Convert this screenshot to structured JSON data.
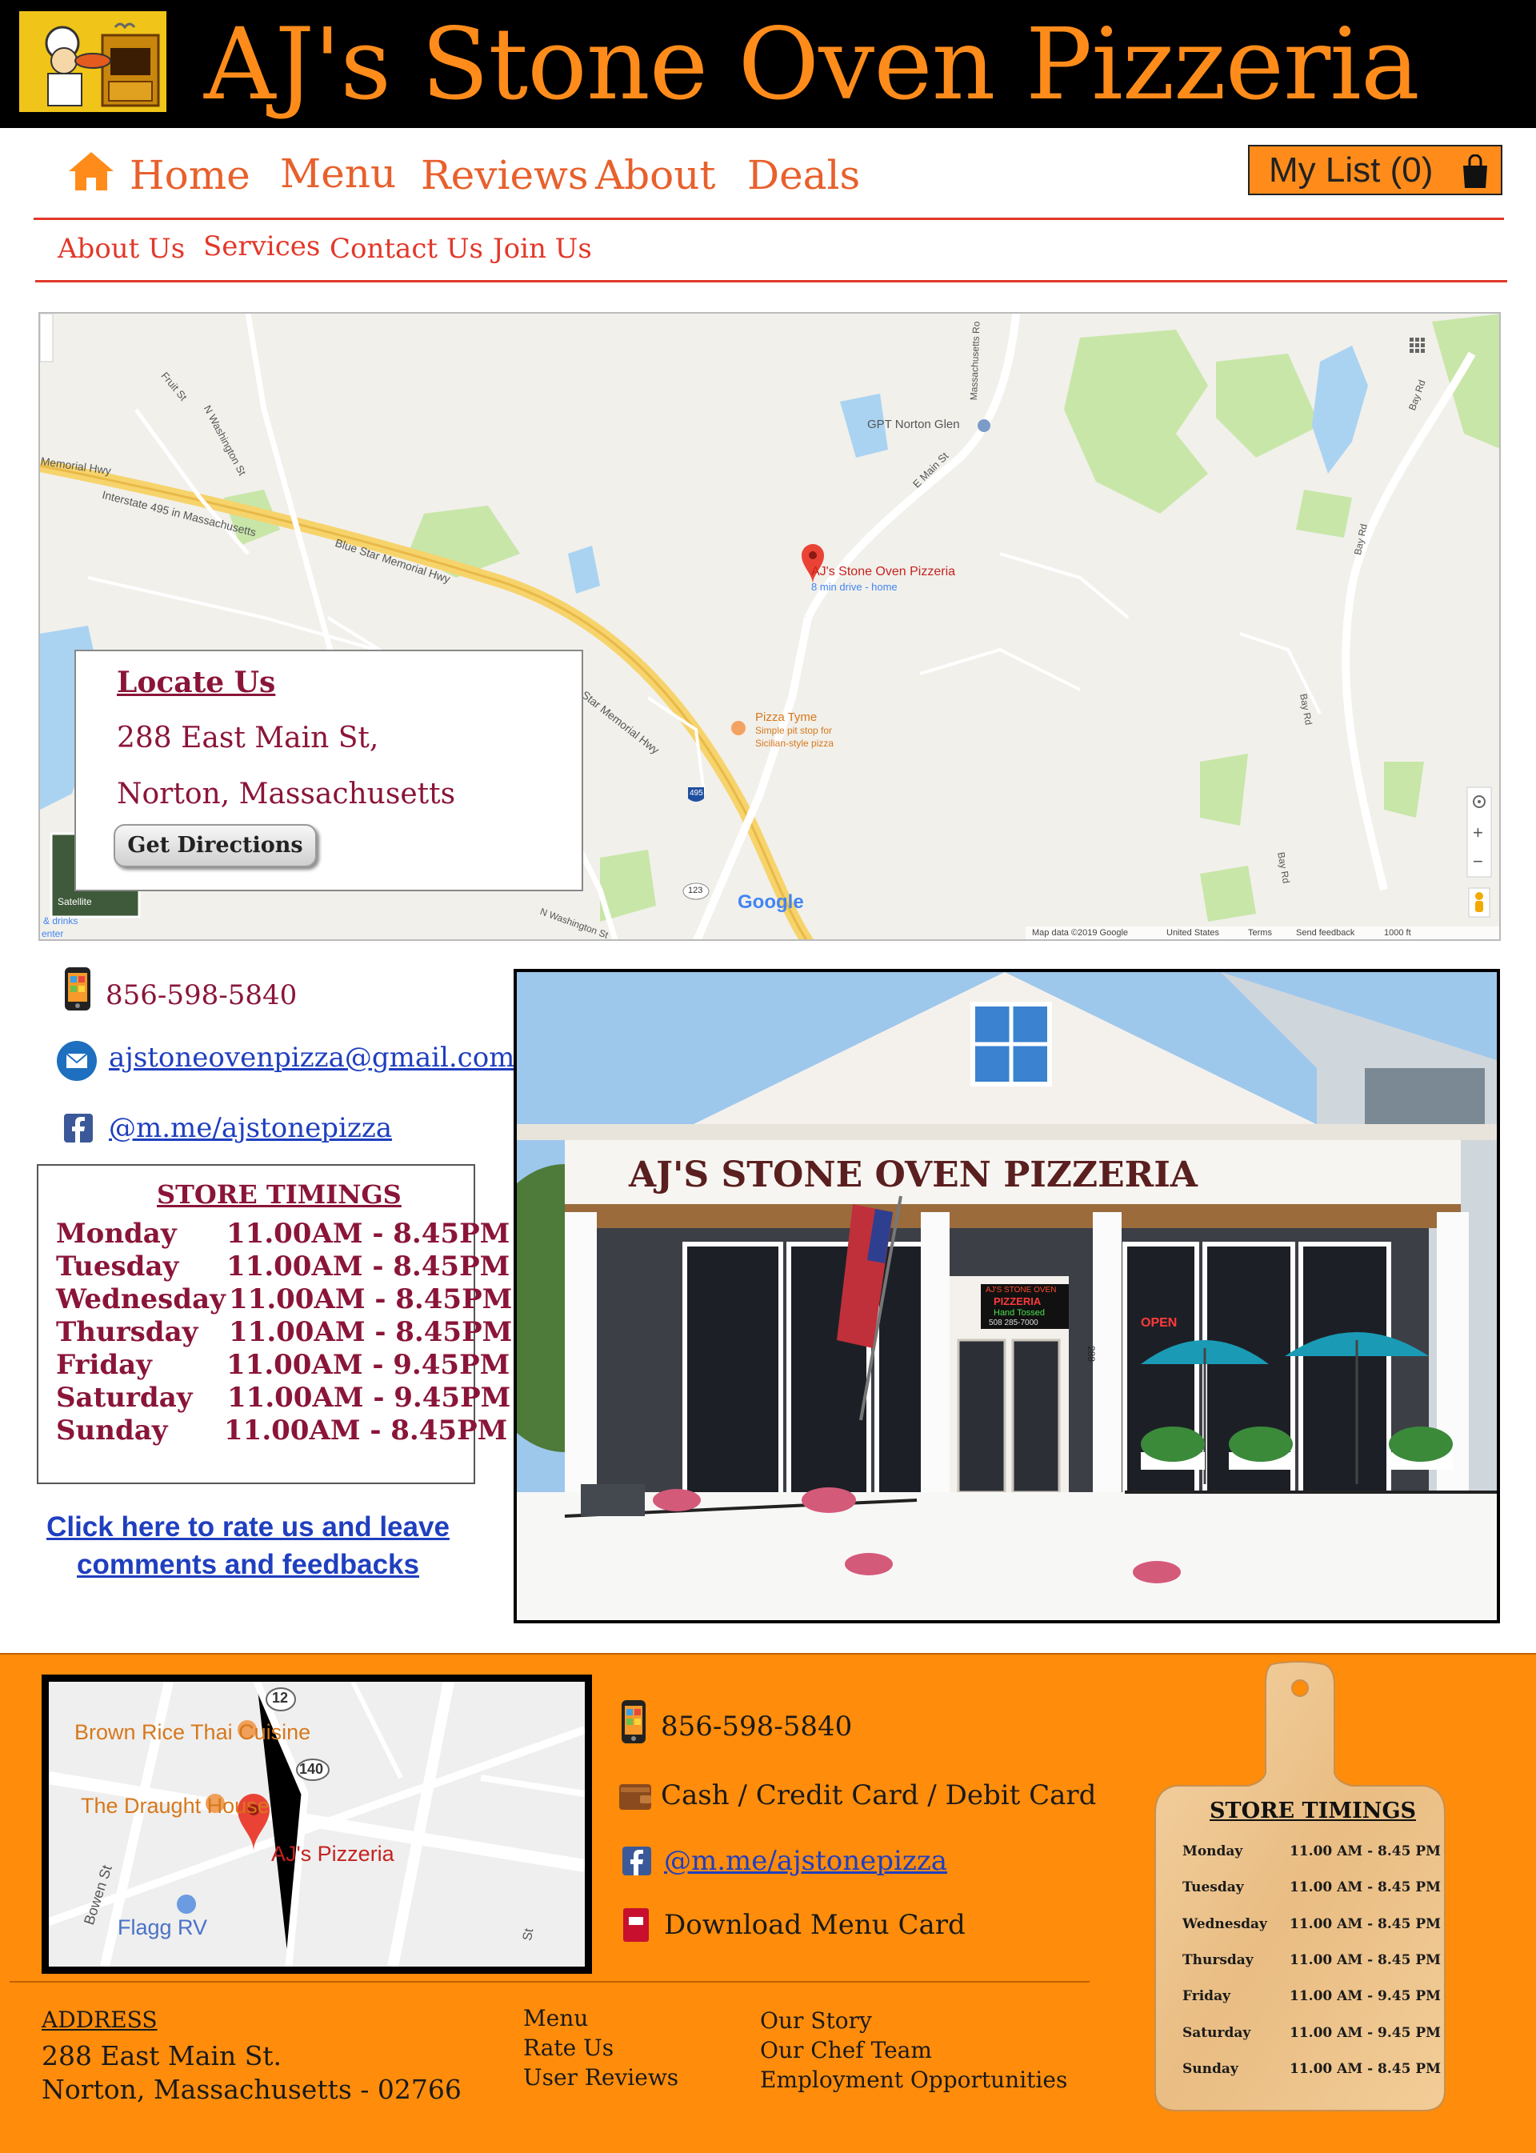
{
  "header": {
    "title": "AJ's Stone Oven Pizzeria"
  },
  "nav": {
    "primary": [
      "Home",
      "Menu",
      "Reviews",
      "About",
      "Deals"
    ],
    "secondary": [
      "About Us",
      "Services",
      "Contact Us",
      "Join Us"
    ],
    "my_list_label": "My List (0)"
  },
  "map": {
    "labels": {
      "marker_name": "AJ's Stone Oven Pizzeria",
      "marker_sub": "8 min drive - home",
      "gpt": "GPT Norton Glen",
      "pizza_tyme": "Pizza Tyme",
      "pizza_tyme_sub1": "Simple pit stop for",
      "pizza_tyme_sub2": "Sicilian-style pizza",
      "interstate": "Interstate 495 in Massachusetts",
      "blue_star": "Blue Star Memorial Hwy",
      "memorial_left": "Memorial Hwy",
      "memorial_right": "Star Memorial Hwy",
      "fruit_st": "Fruit St",
      "nwash_top": "N Washington St",
      "nwash_bottom": "N Washington St",
      "e_main": "E Main St",
      "mass_rd": "Massachusetts Ro",
      "bay_rd1": "Bay Rd",
      "bay_rd2": "Bay Rd",
      "bay_rd3": "Bay Rd",
      "bay_rd4": "Bay Rd",
      "shield_495": "495",
      "shield_123": "123",
      "satellite": "Satellite",
      "drinks": "& drinks",
      "center": "enter",
      "google": "Google",
      "footer_map_data": "Map data ©2019 Google",
      "footer_us": "United States",
      "footer_terms": "Terms",
      "footer_feedback": "Send feedback",
      "footer_scale": "1000 ft"
    },
    "zoom_in": "+",
    "zoom_out": "−"
  },
  "locate": {
    "heading": "Locate Us",
    "line1": "288 East Main St,",
    "line2": "Norton, Massachusetts",
    "button": "Get Directions"
  },
  "contact": {
    "phone": "856-598-5840",
    "email": "ajstoneovenpizza@gmail.com",
    "facebook": "@m.me/ajstonepizza"
  },
  "timings": {
    "heading": "STORE TIMINGS",
    "rows": [
      {
        "day": "Monday",
        "hours": "11.00AM - 8.45PM"
      },
      {
        "day": "Tuesday",
        "hours": "11.00AM - 8.45PM"
      },
      {
        "day": "Wednesday",
        "hours": "11.00AM - 8.45PM"
      },
      {
        "day": "Thursday",
        "hours": "11.00AM - 8.45PM"
      },
      {
        "day": "Friday",
        "hours": "11.00AM - 9.45PM"
      },
      {
        "day": "Saturday",
        "hours": "11.00AM - 9.45PM"
      },
      {
        "day": "Sunday",
        "hours": "11.00AM - 8.45PM"
      }
    ]
  },
  "rate": {
    "line1": "Click here to rate us and leave",
    "line2": "comments and feedbacks"
  },
  "photo": {
    "sign": "AJ'S STONE OVEN PIZZERIA",
    "window_sign1": "AJ'S STONE OVEN",
    "window_sign2": "PIZZERIA",
    "window_sign3": "Hand Tossed",
    "window_sign4": "508 285-7000",
    "open_sign": "OPEN",
    "house_number": "288"
  },
  "footer": {
    "map_labels": {
      "brown_rice": "Brown Rice Thai Cuisine",
      "draught": "The Draught House",
      "ajs": "AJ's Pizzeria",
      "flagg": "Flagg RV",
      "bowen": "Bowen St",
      "route12": "12",
      "route140": "140",
      "st": "St"
    },
    "phone": "856-598-5840",
    "payment": "Cash / Credit Card / Debit Card",
    "facebook": "@m.me/ajstonepizza",
    "download": "Download Menu Card",
    "address_heading": "ADDRESS",
    "address_line1": "288 East Main St.",
    "address_line2": "Norton, Massachusetts - 02766",
    "links_col1": [
      "Menu",
      "Rate Us",
      "User Reviews"
    ],
    "links_col2": [
      "Our Story",
      "Our Chef Team",
      "Employment Opportunities"
    ],
    "board_heading": "STORE TIMINGS",
    "board_rows": [
      {
        "day": "Monday",
        "hours": "11.00 AM - 8.45 PM"
      },
      {
        "day": "Tuesday",
        "hours": "11.00 AM - 8.45 PM"
      },
      {
        "day": "Wednesday",
        "hours": "11.00 AM - 8.45 PM"
      },
      {
        "day": "Thursday",
        "hours": "11.00 AM - 8.45 PM"
      },
      {
        "day": "Friday",
        "hours": "11.00 AM - 9.45 PM"
      },
      {
        "day": "Saturday",
        "hours": "11.00 AM - 9.45 PM"
      },
      {
        "day": "Sunday",
        "hours": "11.00 AM - 8.45 PM"
      }
    ]
  },
  "colors": {
    "brand_orange": "#ff8c1a",
    "nav_orange": "#e8602c",
    "nav_red": "#e2382a",
    "maroon": "#8a1538",
    "link_blue": "#1f3fbf",
    "footer_orange": "#ff8c0a"
  },
  "icons": [
    "pizza-chef-logo",
    "home-icon",
    "shopping-bag-icon",
    "phone-icon",
    "mail-icon",
    "facebook-icon",
    "wallet-icon",
    "menu-card-icon",
    "map-pin-icon",
    "locate-me-icon",
    "pegman-icon",
    "apps-grid-icon"
  ]
}
